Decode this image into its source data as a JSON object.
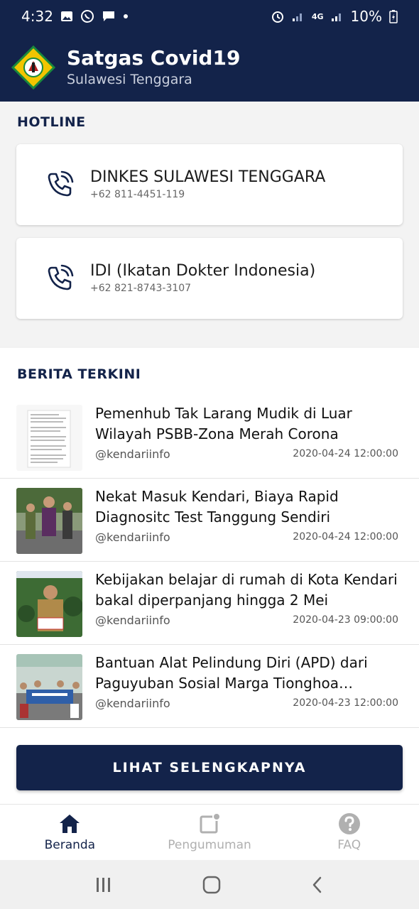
{
  "status_bar": {
    "time": "4:32",
    "battery": "10%",
    "net": "4G"
  },
  "header": {
    "title": "Satgas Covid19",
    "subtitle": "Sulawesi Tenggara"
  },
  "hotline": {
    "section_title": "HOTLINE",
    "items": [
      {
        "name": "DINKES SULAWESI TENGGARA",
        "number": "+62 811-4451-119"
      },
      {
        "name": "IDI (Ikatan Dokter Indonesia)",
        "number": "+62 821-8743-3107"
      }
    ]
  },
  "news": {
    "section_title": "BERITA TERKINI",
    "items": [
      {
        "title": "Pemenhub Tak Larang Mudik di Luar Wilayah PSBB-Zona Merah Corona",
        "source": "@kendariinfo",
        "date": "2020-04-24 12:00:00"
      },
      {
        "title": "Nekat Masuk Kendari, Biaya Rapid Diagnositc Test Tanggung Sendiri",
        "source": "@kendariinfo",
        "date": "2020-04-24 12:00:00"
      },
      {
        "title": "Kebijakan belajar di rumah di Kota Kendari bakal diperpanjang hingga 2 Mei",
        "source": "@kendariinfo",
        "date": "2020-04-23 09:00:00"
      },
      {
        "title": "Bantuan Alat Pelindung Diri (APD) dari Paguyuban Sosial Marga Tionghoa Indone...",
        "source": "@kendariinfo",
        "date": "2020-04-23 12:00:00"
      }
    ],
    "more_label": "LIHAT SELENGKAPNYA"
  },
  "bottom_nav": {
    "items": [
      {
        "label": "Beranda",
        "icon": "home-icon"
      },
      {
        "label": "Pengumuman",
        "icon": "announcement-icon"
      },
      {
        "label": "FAQ",
        "icon": "help-icon"
      }
    ]
  },
  "colors": {
    "primary": "#13234a",
    "inactive": "#b0b0b0",
    "logo_yellow": "#f2c500",
    "logo_green": "#1a8a3c"
  }
}
